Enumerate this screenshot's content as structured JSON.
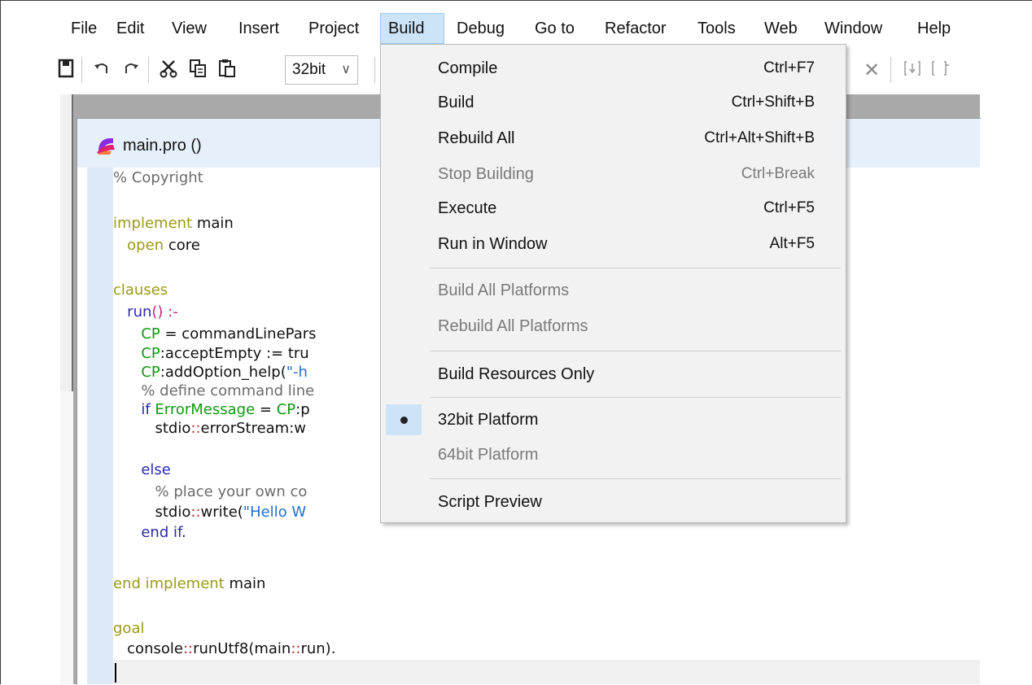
{
  "menubar": {
    "items": [
      {
        "label": "File"
      },
      {
        "label": "Edit"
      },
      {
        "label": "View"
      },
      {
        "label": "Insert"
      },
      {
        "label": "Project"
      },
      {
        "label": "Build"
      },
      {
        "label": "Debug"
      },
      {
        "label": "Go to"
      },
      {
        "label": "Refactor"
      },
      {
        "label": "Tools"
      },
      {
        "label": "Web"
      },
      {
        "label": "Window"
      },
      {
        "label": "Help"
      }
    ],
    "active": "Build"
  },
  "toolbar": {
    "platform_combo": "32bit",
    "icons": [
      "save-icon",
      "undo-icon",
      "redo-icon",
      "cut-icon",
      "copy-icon",
      "paste-icon",
      "close-icon",
      "step-into-icon",
      "step-out-icon"
    ]
  },
  "editor": {
    "title": "main.pro ()",
    "colors": {
      "keyword": "#9a9a1a",
      "comment": "#6b6b6b",
      "variable": "#119911",
      "string": "#1f6fd0"
    },
    "lines": {
      "l1": "% Copyright",
      "l2a": "implement",
      "l2b": " main",
      "l3a": "   open",
      "l3b": " core",
      "l4": "clauses",
      "l5a": "   run",
      "l5b": "() :-",
      "l6a": "      CP",
      "l6b": " = commandLinePars",
      "l7a": "      CP",
      "l7b": ":acceptEmpty := tru",
      "l8a": "      CP",
      "l8b": ":addOption_help(",
      "l8c": "\"-h",
      "l9": "      % define command line",
      "l10a": "      if ",
      "l10b": "ErrorMessage",
      "l10c": " = ",
      "l10d": "CP",
      "l10e": ":p",
      "l11a": "         stdio",
      "l11b": "::",
      "l11c": "errorStream:w",
      "l12": "      else",
      "l13": "         % place your own co",
      "l14a": "         stdio",
      "l14b": "::",
      "l14c": "write(",
      "l14d": "\"Hello W",
      "l15a": "      end if",
      "l15b": ".",
      "l16a": "end implement",
      "l16b": " main",
      "l17": "goal",
      "l18a": "   console",
      "l18b": "::",
      "l18c": "runUtf8(main",
      "l18d": "::",
      "l18e": "run)."
    }
  },
  "build_menu": {
    "compile": {
      "label": "Compile",
      "shortcut": "Ctrl+F7"
    },
    "build": {
      "label": "Build",
      "shortcut": "Ctrl+Shift+B"
    },
    "rebuild_all": {
      "label": "Rebuild All",
      "shortcut": "Ctrl+Alt+Shift+B"
    },
    "stop_building": {
      "label": "Stop Building",
      "shortcut": "Ctrl+Break",
      "enabled": false
    },
    "execute": {
      "label": "Execute",
      "shortcut": "Ctrl+F5"
    },
    "run_in_window": {
      "label": "Run in Window",
      "shortcut": "Alt+F5"
    },
    "build_all_platforms": {
      "label": "Build All Platforms",
      "enabled": false
    },
    "rebuild_all_platforms": {
      "label": "Rebuild All Platforms",
      "enabled": false
    },
    "build_resources_only": {
      "label": "Build Resources Only"
    },
    "platform_32": {
      "label": "32bit Platform",
      "selected": true
    },
    "platform_64": {
      "label": "64bit Platform",
      "enabled": false
    },
    "script_preview": {
      "label": "Script Preview"
    }
  }
}
